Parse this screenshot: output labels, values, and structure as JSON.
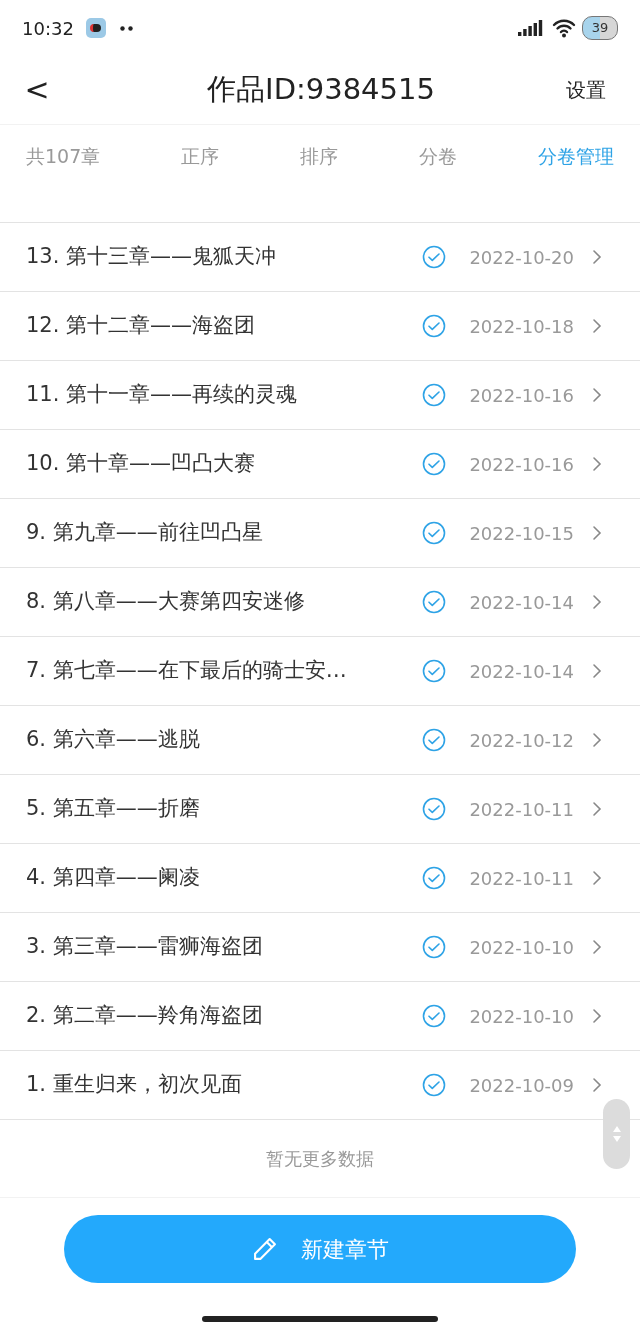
{
  "status_bar": {
    "time": "10:32",
    "battery": "39"
  },
  "header": {
    "back": "<",
    "title": "作品ID:9384515",
    "action": "设置"
  },
  "toolbar": {
    "count": "共107章",
    "tabs": [
      {
        "label": "正序",
        "selected": false
      },
      {
        "label": "排序",
        "selected": false
      },
      {
        "label": "分卷",
        "selected": false
      },
      {
        "label": "分卷管理",
        "selected": true
      }
    ]
  },
  "chapters": [
    {
      "title": "13. 第十三章——鬼狐天冲",
      "date": "2022-10-20"
    },
    {
      "title": "12. 第十二章——海盗团",
      "date": "2022-10-18"
    },
    {
      "title": "11. 第十一章——再续的灵魂",
      "date": "2022-10-16"
    },
    {
      "title": "10. 第十章——凹凸大赛",
      "date": "2022-10-16"
    },
    {
      "title": "9. 第九章——前往凹凸星",
      "date": "2022-10-15"
    },
    {
      "title": "8. 第八章——大赛第四安迷修",
      "date": "2022-10-14"
    },
    {
      "title": "7. 第七章——在下最后的骑士安…",
      "date": "2022-10-14"
    },
    {
      "title": "6. 第六章——逃脱",
      "date": "2022-10-12"
    },
    {
      "title": "5. 第五章——折磨",
      "date": "2022-10-11"
    },
    {
      "title": "4. 第四章——阑凌",
      "date": "2022-10-11"
    },
    {
      "title": "3. 第三章——雷狮海盗团",
      "date": "2022-10-10"
    },
    {
      "title": "2. 第二章——羚角海盗团",
      "date": "2022-10-10"
    },
    {
      "title": "1. 重生归来，初次见面",
      "date": "2022-10-09"
    }
  ],
  "footer_note": "暂无更多数据",
  "new_button": "新建章节"
}
